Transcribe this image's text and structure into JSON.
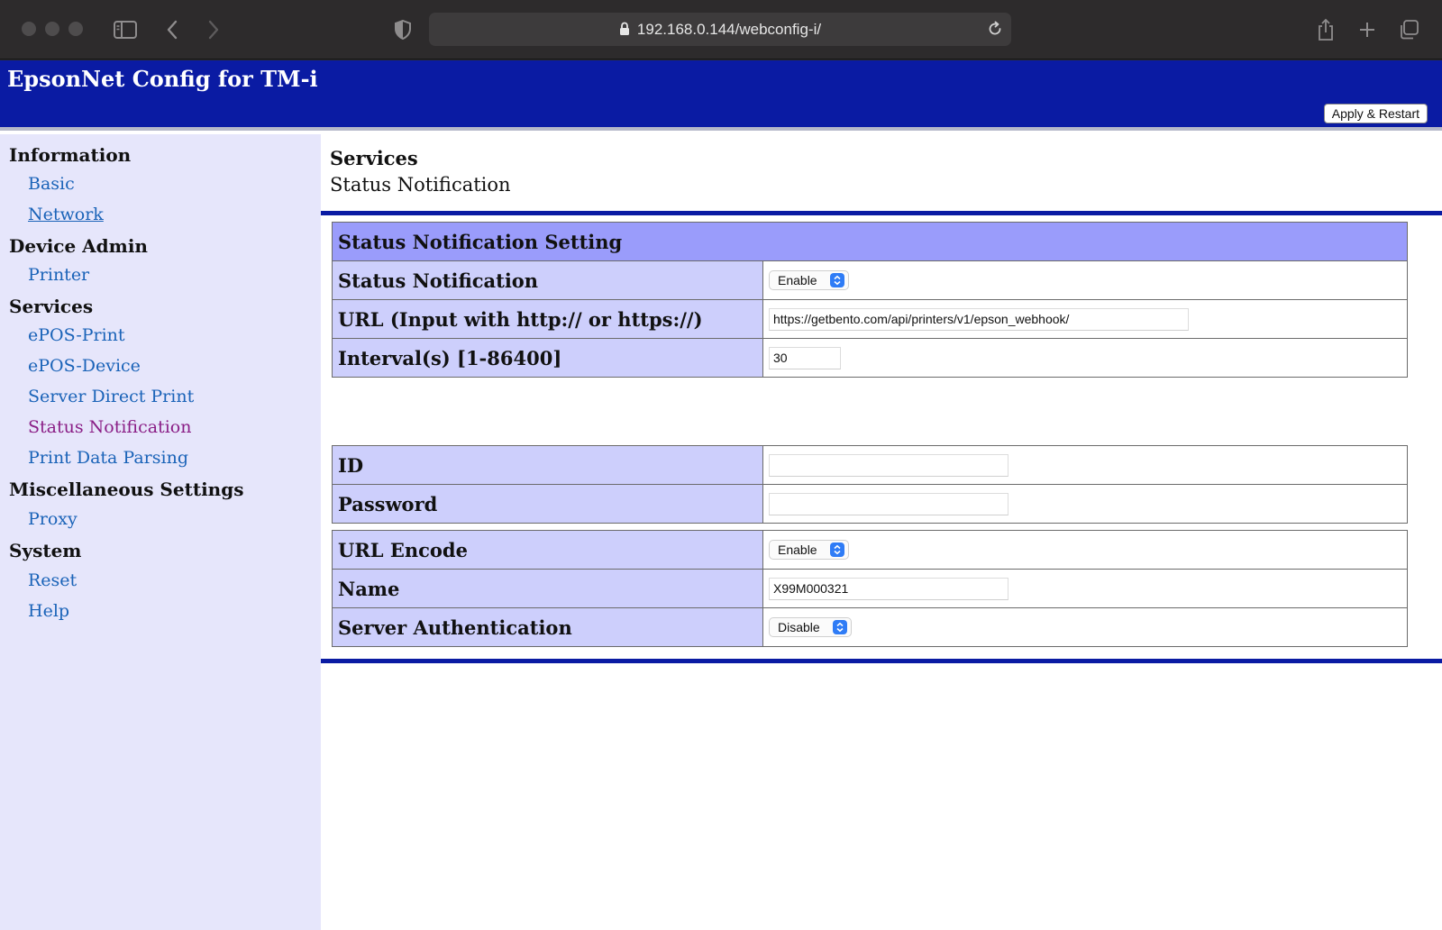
{
  "browser": {
    "url": "192.168.0.144/webconfig-i/"
  },
  "header": {
    "title": "EpsonNet Config for TM-i",
    "apply_label": "Apply & Restart"
  },
  "sidebar": {
    "sections": [
      {
        "title": "Information",
        "items": [
          "Basic",
          "Network"
        ]
      },
      {
        "title": "Device Admin",
        "items": [
          "Printer"
        ]
      },
      {
        "title": "Services",
        "items": [
          "ePOS-Print",
          "ePOS-Device",
          "Server Direct Print",
          "Status Notification",
          "Print Data Parsing"
        ]
      },
      {
        "title": "Miscellaneous Settings",
        "items": [
          "Proxy"
        ]
      },
      {
        "title": "System",
        "items": [
          "Reset",
          "Help"
        ]
      }
    ]
  },
  "content": {
    "section": "Services",
    "page": "Status Notification",
    "table_title": "Status Notification Setting",
    "rows": {
      "status_notification": {
        "label": "Status Notification",
        "value": "Enable"
      },
      "url": {
        "label": "URL (Input with http:// or https://)",
        "value": "https://getbento.com/api/printers/v1/epson_webhook/"
      },
      "interval": {
        "label": "Interval(s) [1-86400]",
        "value": "30"
      },
      "id": {
        "label": "ID",
        "value": ""
      },
      "password": {
        "label": "Password",
        "value": ""
      },
      "url_encode": {
        "label": "URL Encode",
        "value": "Enable"
      },
      "name": {
        "label": "Name",
        "value": "X99M000321"
      },
      "server_auth": {
        "label": "Server Authentication",
        "value": "Disable"
      }
    }
  }
}
